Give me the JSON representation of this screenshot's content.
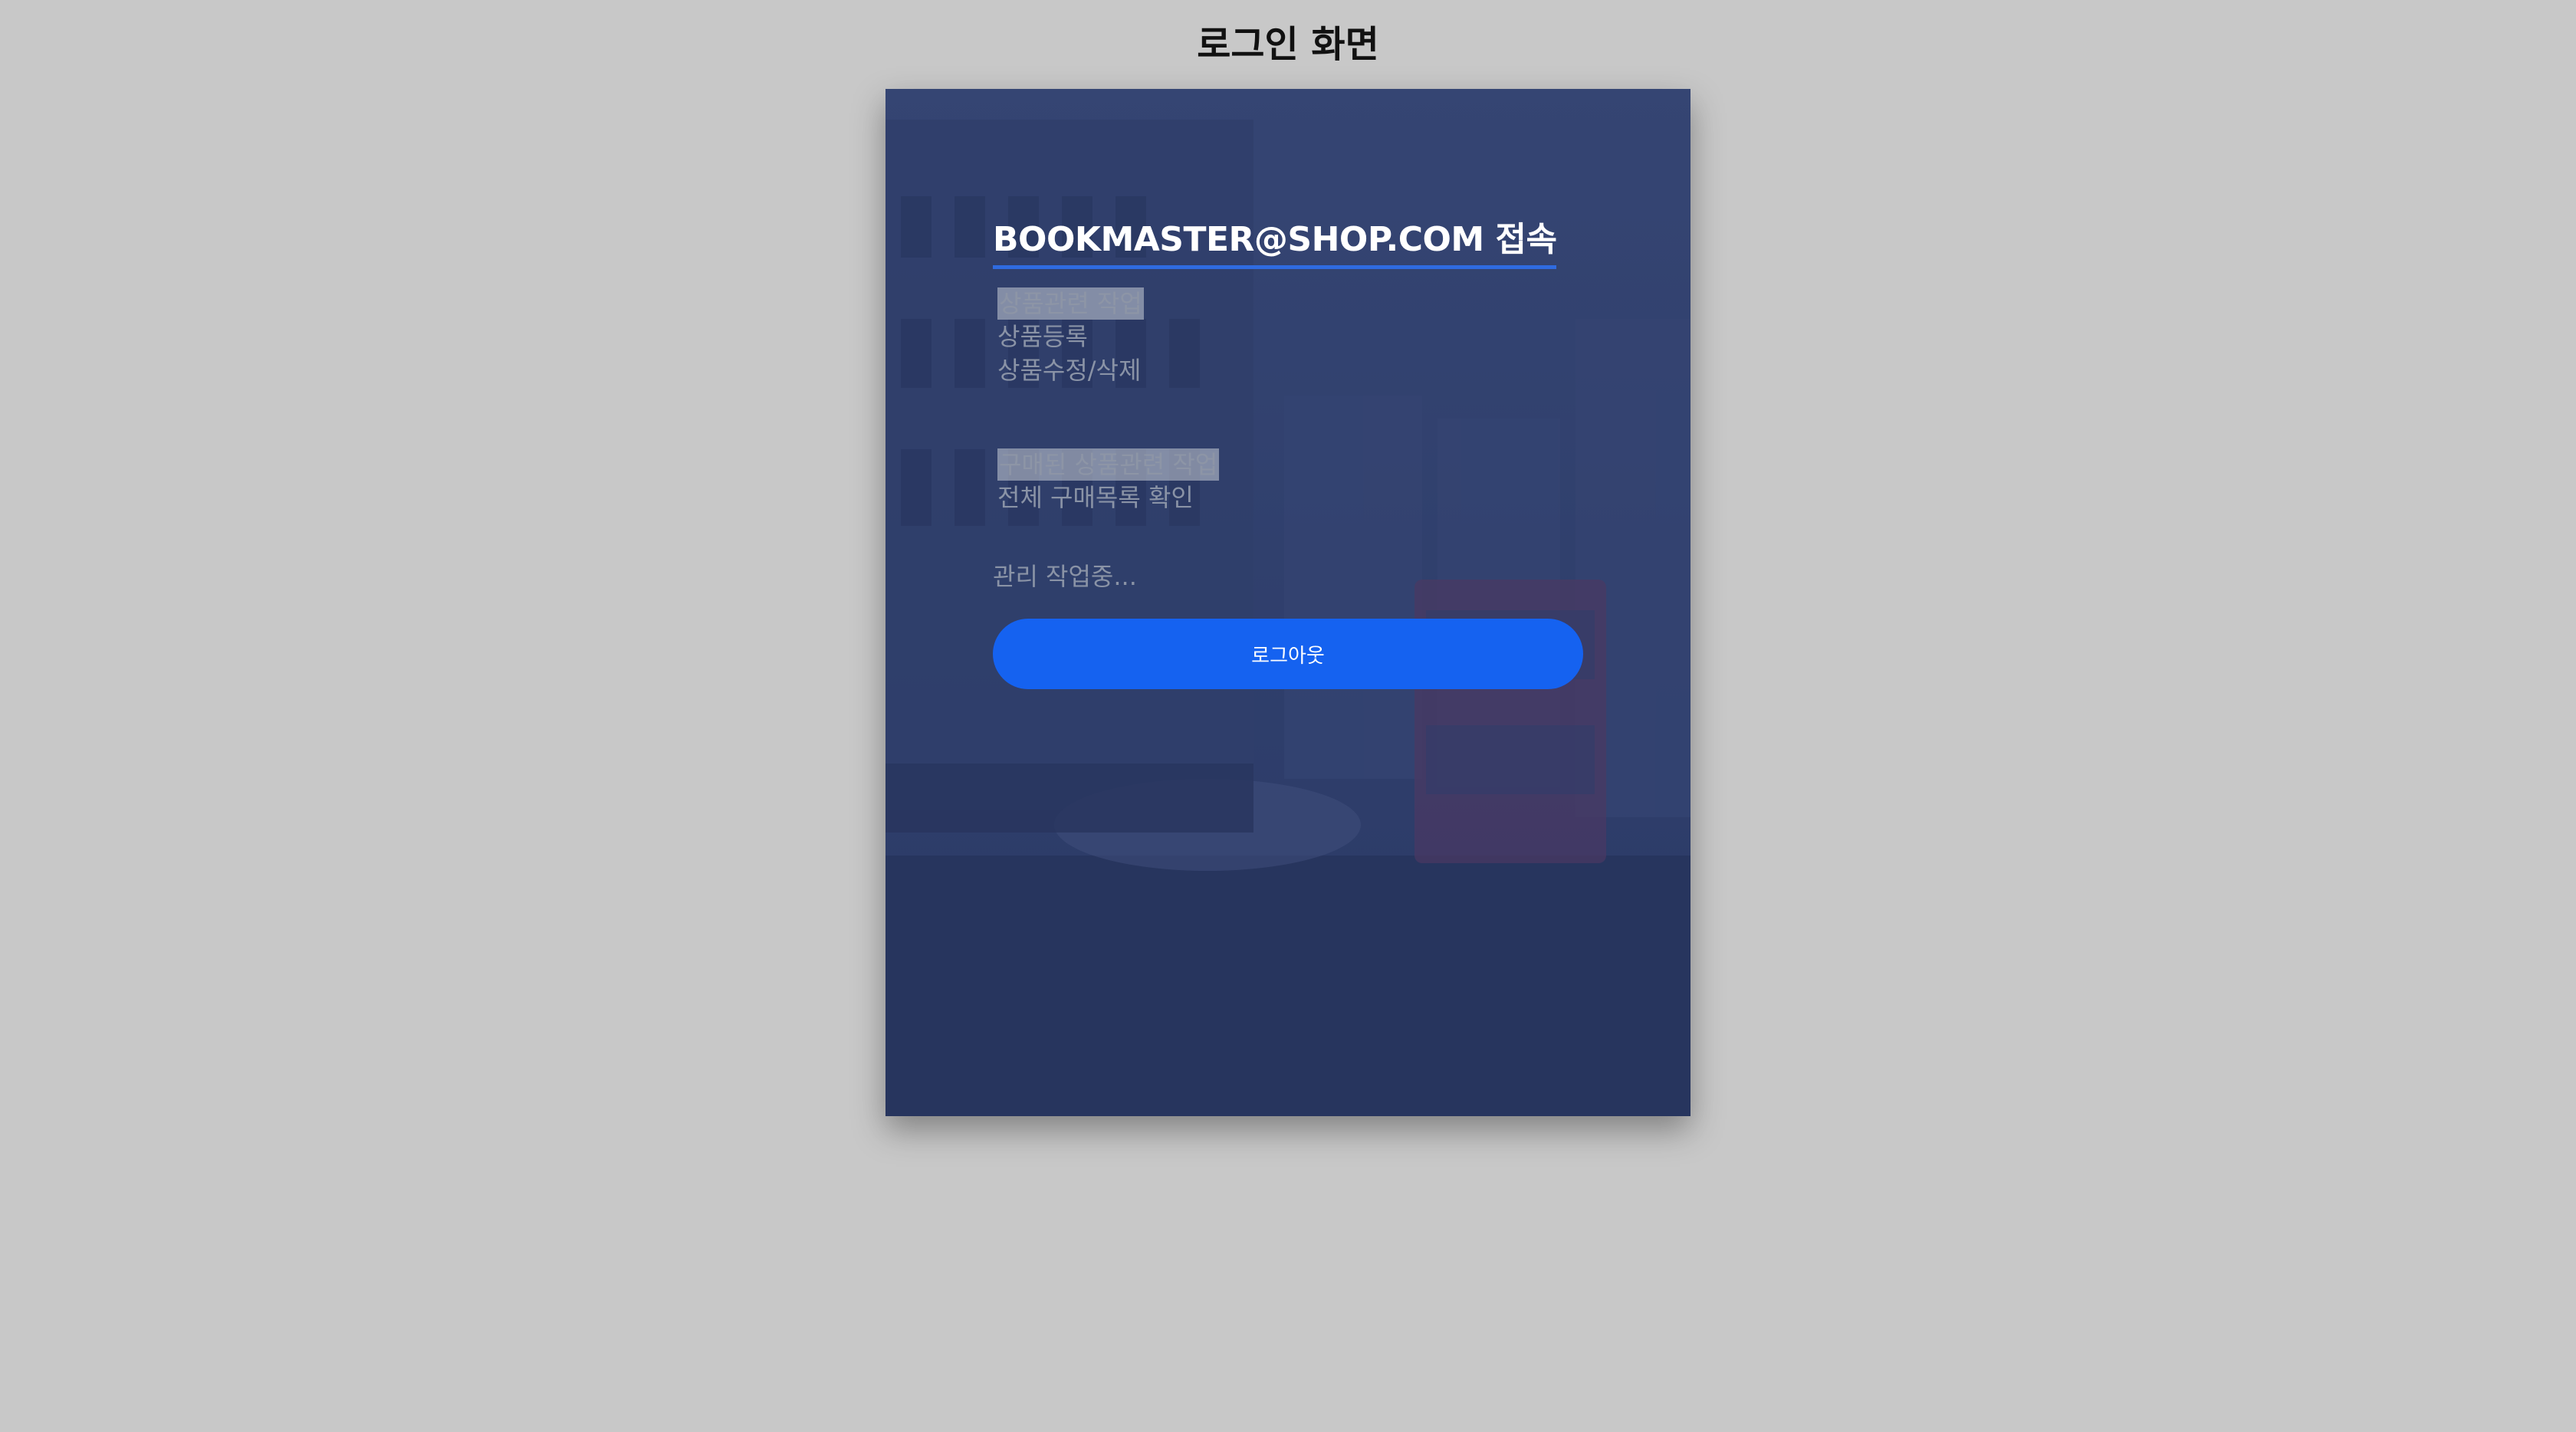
{
  "page": {
    "title": "로그인 화면"
  },
  "account": {
    "title": "BOOKMASTER@SHOP.COM 접속"
  },
  "menu": {
    "product_group": {
      "heading": "상품관련 작업",
      "items": [
        "상품등록",
        "상품수정/삭제"
      ]
    },
    "purchase_group": {
      "heading": "구매된 상품관련 작업",
      "items": [
        "전체 구매목록 확인"
      ]
    }
  },
  "status": {
    "text": "관리 작업중..."
  },
  "actions": {
    "logout_label": "로그아웃"
  },
  "colors": {
    "page_background": "#c8c8c8",
    "card_overlay": "#2b3a66",
    "accent": "#1562f0",
    "underline": "#2f6be0"
  }
}
